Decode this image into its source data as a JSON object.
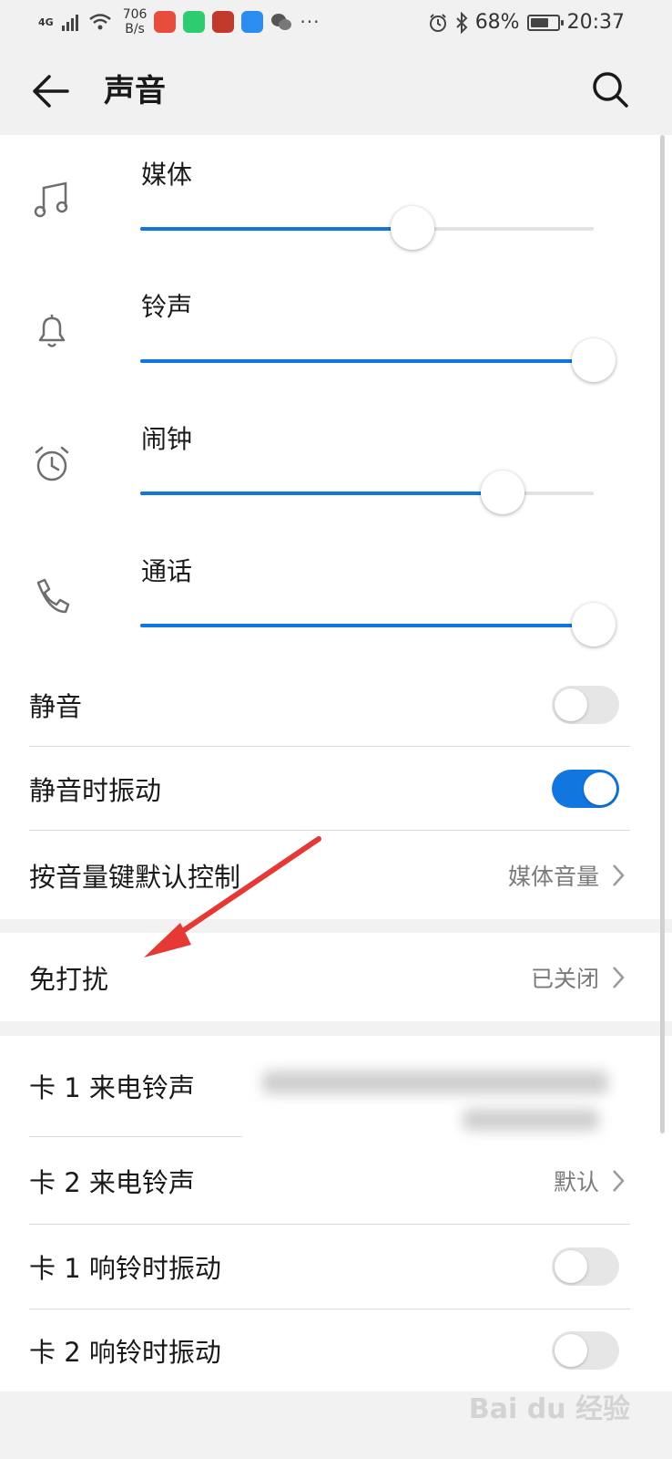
{
  "status_bar": {
    "network": "4G",
    "speed_value": "706",
    "speed_unit": "B/s",
    "more": "···",
    "battery_percent": "68%",
    "battery_level": 0.68,
    "time": "20:37",
    "app_icons": [
      "video-app-icon",
      "green-app-icon",
      "game-app-icon",
      "chat-app-icon",
      "wechat-icon"
    ]
  },
  "header": {
    "title": "声音"
  },
  "volumes": [
    {
      "label": "媒体",
      "icon": "music-note-icon",
      "level": 0.6
    },
    {
      "label": "铃声",
      "icon": "bell-icon",
      "level": 1.0
    },
    {
      "label": "闹钟",
      "icon": "alarm-clock-icon",
      "level": 0.8
    },
    {
      "label": "通话",
      "icon": "phone-icon",
      "level": 1.0
    }
  ],
  "settings": {
    "mute": {
      "label": "静音",
      "enabled": false
    },
    "vibrate_on_mute": {
      "label": "静音时振动",
      "enabled": true
    },
    "volume_key": {
      "label": "按音量键默认控制",
      "value": "媒体音量"
    },
    "dnd": {
      "label": "免打扰",
      "value": "已关闭"
    },
    "sim1_ringtone": {
      "label": "卡 1 来电铃声"
    },
    "sim2_ringtone": {
      "label": "卡 2 来电铃声",
      "value": "默认"
    },
    "sim1_vibrate": {
      "label": "卡 1 响铃时振动",
      "enabled": false
    },
    "sim2_vibrate": {
      "label": "卡 2 响铃时振动",
      "enabled": false
    }
  },
  "colors": {
    "accent": "#1276e0",
    "annotation": "#e53935"
  },
  "watermark": "Bai du 经验"
}
